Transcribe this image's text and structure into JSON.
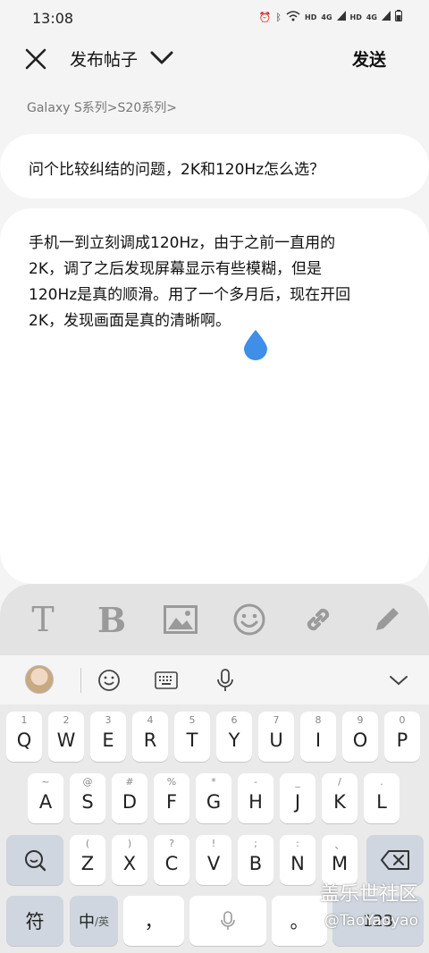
{
  "status": {
    "time": "13:08",
    "hd1": "HD",
    "sig1": "4G",
    "hd2": "HD",
    "sig2": "4G"
  },
  "appbar": {
    "title": "发布帖子",
    "send_label": "发送"
  },
  "breadcrumb": "Galaxy S系列>S20系列>",
  "post": {
    "title": "问个比较纠结的问题，2K和120Hz怎么选？",
    "body_lines": [
      "手机一到立刻调成120Hz，由于之前一直用的",
      "2K，调了之后发现屏幕显示有些模糊，但是",
      "120Hz是真的顺滑。用了一个多月后，现在开回",
      "2K，发现画面是真的清晰啊。"
    ]
  },
  "toolbar": {
    "text_icon": "T",
    "bold_icon": "B"
  },
  "keyboard": {
    "row1": [
      {
        "sub": "1",
        "main": "Q"
      },
      {
        "sub": "2",
        "main": "W"
      },
      {
        "sub": "3",
        "main": "E"
      },
      {
        "sub": "4",
        "main": "R"
      },
      {
        "sub": "5",
        "main": "T"
      },
      {
        "sub": "6",
        "main": "Y"
      },
      {
        "sub": "7",
        "main": "U"
      },
      {
        "sub": "8",
        "main": "I"
      },
      {
        "sub": "9",
        "main": "O"
      },
      {
        "sub": "0",
        "main": "P"
      }
    ],
    "row2": [
      {
        "sub": "~",
        "main": "A"
      },
      {
        "sub": "@",
        "main": "S"
      },
      {
        "sub": "#",
        "main": "D"
      },
      {
        "sub": "%",
        "main": "F"
      },
      {
        "sub": "*",
        "main": "G"
      },
      {
        "sub": "-",
        "main": "H"
      },
      {
        "sub": "_",
        "main": "J"
      },
      {
        "sub": "/",
        "main": "K"
      },
      {
        "sub": ".",
        "main": "L"
      }
    ],
    "row3": [
      {
        "sub": "(",
        "main": "Z"
      },
      {
        "sub": ")",
        "main": "X"
      },
      {
        "sub": "?",
        "main": "C"
      },
      {
        "sub": "!",
        "main": "V"
      },
      {
        "sub": ";",
        "main": "B"
      },
      {
        "sub": ":",
        "main": "N"
      },
      {
        "sub": "、",
        "main": "M"
      }
    ],
    "sym_label": "符",
    "lang_main": "中",
    "lang_sub": "/英",
    "comma_label": "，",
    "period_label": "。",
    "num_label": "123"
  },
  "watermark": {
    "line1": "盖乐世社区",
    "line2": "@TaoYaoyao"
  }
}
